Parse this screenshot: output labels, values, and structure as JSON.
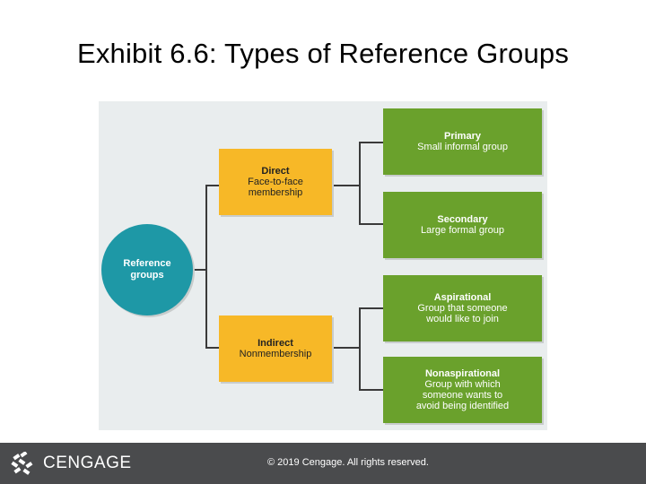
{
  "title": "Exhibit 6.6: Types of Reference Groups",
  "diagram": {
    "root": {
      "line1": "Reference",
      "line2": "groups"
    },
    "direct": {
      "title": "Direct",
      "line1": "Face-to-face",
      "line2": "membership"
    },
    "indirect": {
      "title": "Indirect",
      "line1": "Nonmembership"
    },
    "primary": {
      "title": "Primary",
      "line1": "Small informal group"
    },
    "secondary": {
      "title": "Secondary",
      "line1": "Large formal group"
    },
    "aspirational": {
      "title": "Aspirational",
      "line1": "Group that someone",
      "line2": "would like to join"
    },
    "nonaspirational": {
      "title": "Nonaspirational",
      "line1": "Group with which",
      "line2": "someone wants to",
      "line3": "avoid being identified"
    }
  },
  "footer": {
    "logo": "CENGAGE",
    "copyright": "© 2019 Cengage. All rights reserved."
  },
  "colors": {
    "circle": "#1e98a6",
    "yellow": "#f7b827",
    "green": "#6aa12c",
    "footer": "#4a4b4d"
  }
}
